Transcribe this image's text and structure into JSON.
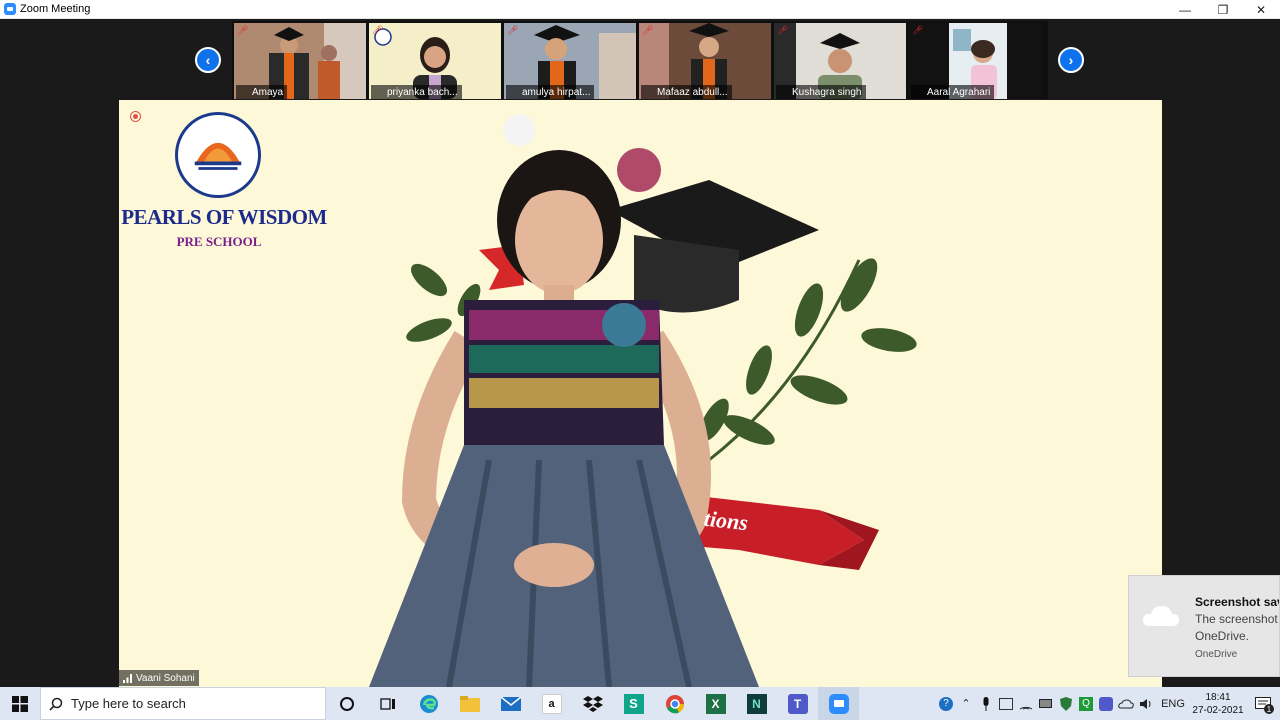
{
  "window": {
    "title": "Zoom Meeting"
  },
  "gallery": {
    "participants": [
      {
        "name": "Amaya"
      },
      {
        "name": "priyanka bach..."
      },
      {
        "name": "amulya hirpat..."
      },
      {
        "name": "Mafaaz abdull..."
      },
      {
        "name": "Kushagra singh"
      },
      {
        "name": "Aaral Agrahari"
      }
    ]
  },
  "main_video": {
    "speaker": "Vaani Sohani",
    "logo_line1": "PEARLS OF WISDOM",
    "logo_line2": "PRE SCHOOL",
    "ribbon_text": "tions"
  },
  "toast": {
    "title": "Screenshot saved",
    "body_line1": "The screenshot was added to your",
    "body_line2": "OneDrive.",
    "source": "OneDrive"
  },
  "taskbar": {
    "search_placeholder": "Type here to search",
    "language": "ENG",
    "time": "18:41",
    "date": "27-02-2021",
    "notification_count": "1"
  },
  "colors": {
    "zoom_blue": "#0e72ed",
    "taskbar": "#dde6f2",
    "stage_bg": "#fdf8d8"
  }
}
